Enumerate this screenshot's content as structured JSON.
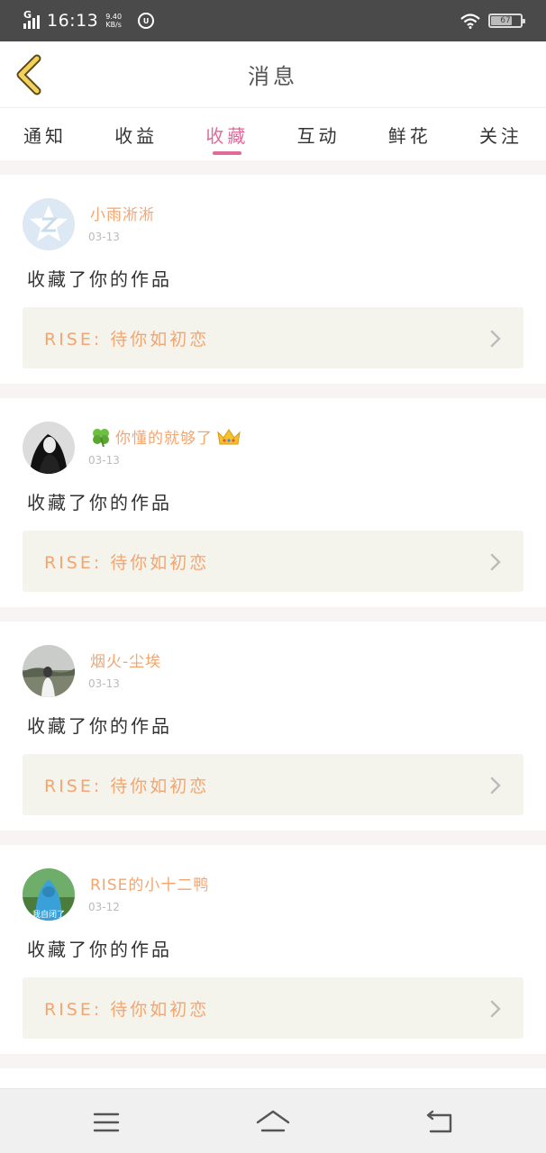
{
  "status_bar": {
    "network": "G",
    "time": "16:13",
    "speed_value": "9.40",
    "speed_unit": "KB/s",
    "badge": "U",
    "battery": "67"
  },
  "header": {
    "title": "消息",
    "back_icon": "chevron-left-icon"
  },
  "tabs": [
    {
      "label": "通知",
      "active": false
    },
    {
      "label": "收益",
      "active": false
    },
    {
      "label": "收藏",
      "active": true
    },
    {
      "label": "互动",
      "active": false
    },
    {
      "label": "鲜花",
      "active": false
    },
    {
      "label": "关注",
      "active": false
    }
  ],
  "items": [
    {
      "user": "小雨淅淅",
      "date": "03-13",
      "action": "收藏了你的作品",
      "work": "RISE: 待你如初恋"
    },
    {
      "user": "你懂的就够了",
      "date": "03-13",
      "action": "收藏了你的作品",
      "work": "RISE: 待你如初恋"
    },
    {
      "user": "烟火-尘埃",
      "date": "03-13",
      "action": "收藏了你的作品",
      "work": "RISE: 待你如初恋"
    },
    {
      "user": "RISE的小十二鸭",
      "date": "03-12",
      "action": "收藏了你的作品",
      "work": "RISE: 待你如初恋",
      "avatar_caption": "我自闭了"
    }
  ],
  "system_nav": [
    "menu-icon",
    "home-icon",
    "back-icon"
  ],
  "colors": {
    "accent": "#e06a9a",
    "name": "#f4a56f",
    "work_bg": "#f4f4ec",
    "status_bar": "#4a4a4a"
  }
}
